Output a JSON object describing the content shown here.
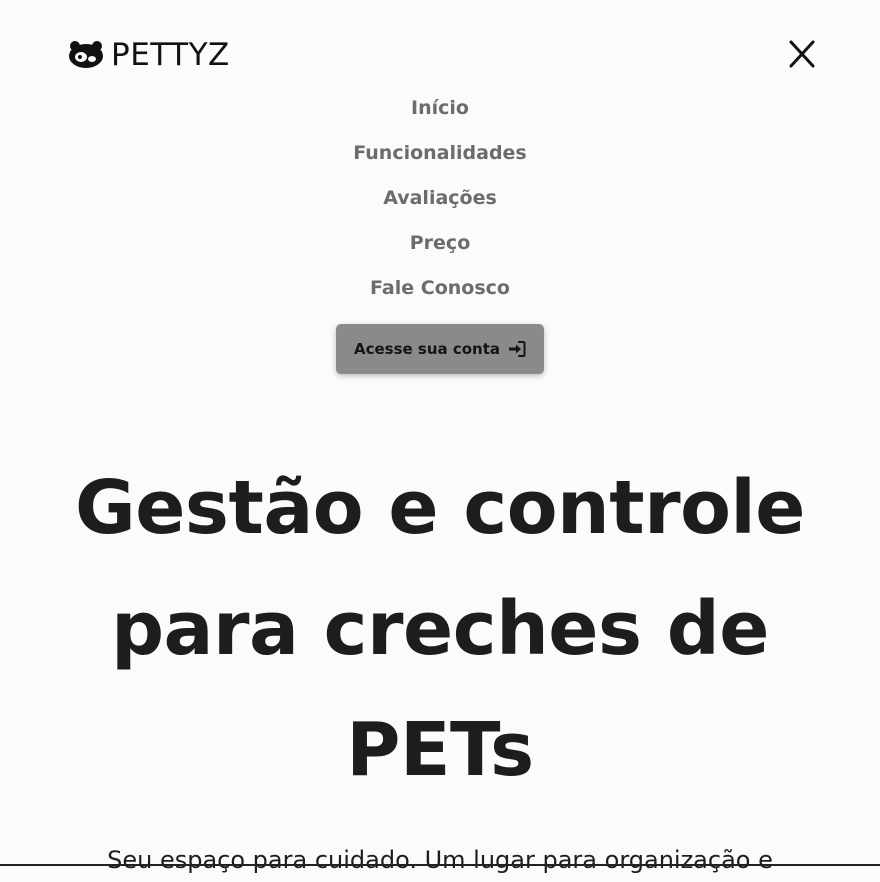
{
  "header": {
    "logo_text": "PETTYZ",
    "close_icon": "close-icon"
  },
  "nav": {
    "items": [
      {
        "label": "Início"
      },
      {
        "label": "Funcionalidades"
      },
      {
        "label": "Avaliações"
      },
      {
        "label": "Preço"
      },
      {
        "label": "Fale Conosco"
      }
    ]
  },
  "login": {
    "label": "Acesse sua conta",
    "icon": "sign-in-icon"
  },
  "hero": {
    "title_line1": "Gestão e controle",
    "title_line2": "para creches de",
    "title_line3": "PETs",
    "subtitle": "Seu espaço para cuidado. Um lugar para organização e"
  },
  "colors": {
    "background": "#fbfbfc",
    "nav_text": "#6c6c6c",
    "button_bg": "#8a8b89",
    "title_text": "#1d1d1d"
  }
}
